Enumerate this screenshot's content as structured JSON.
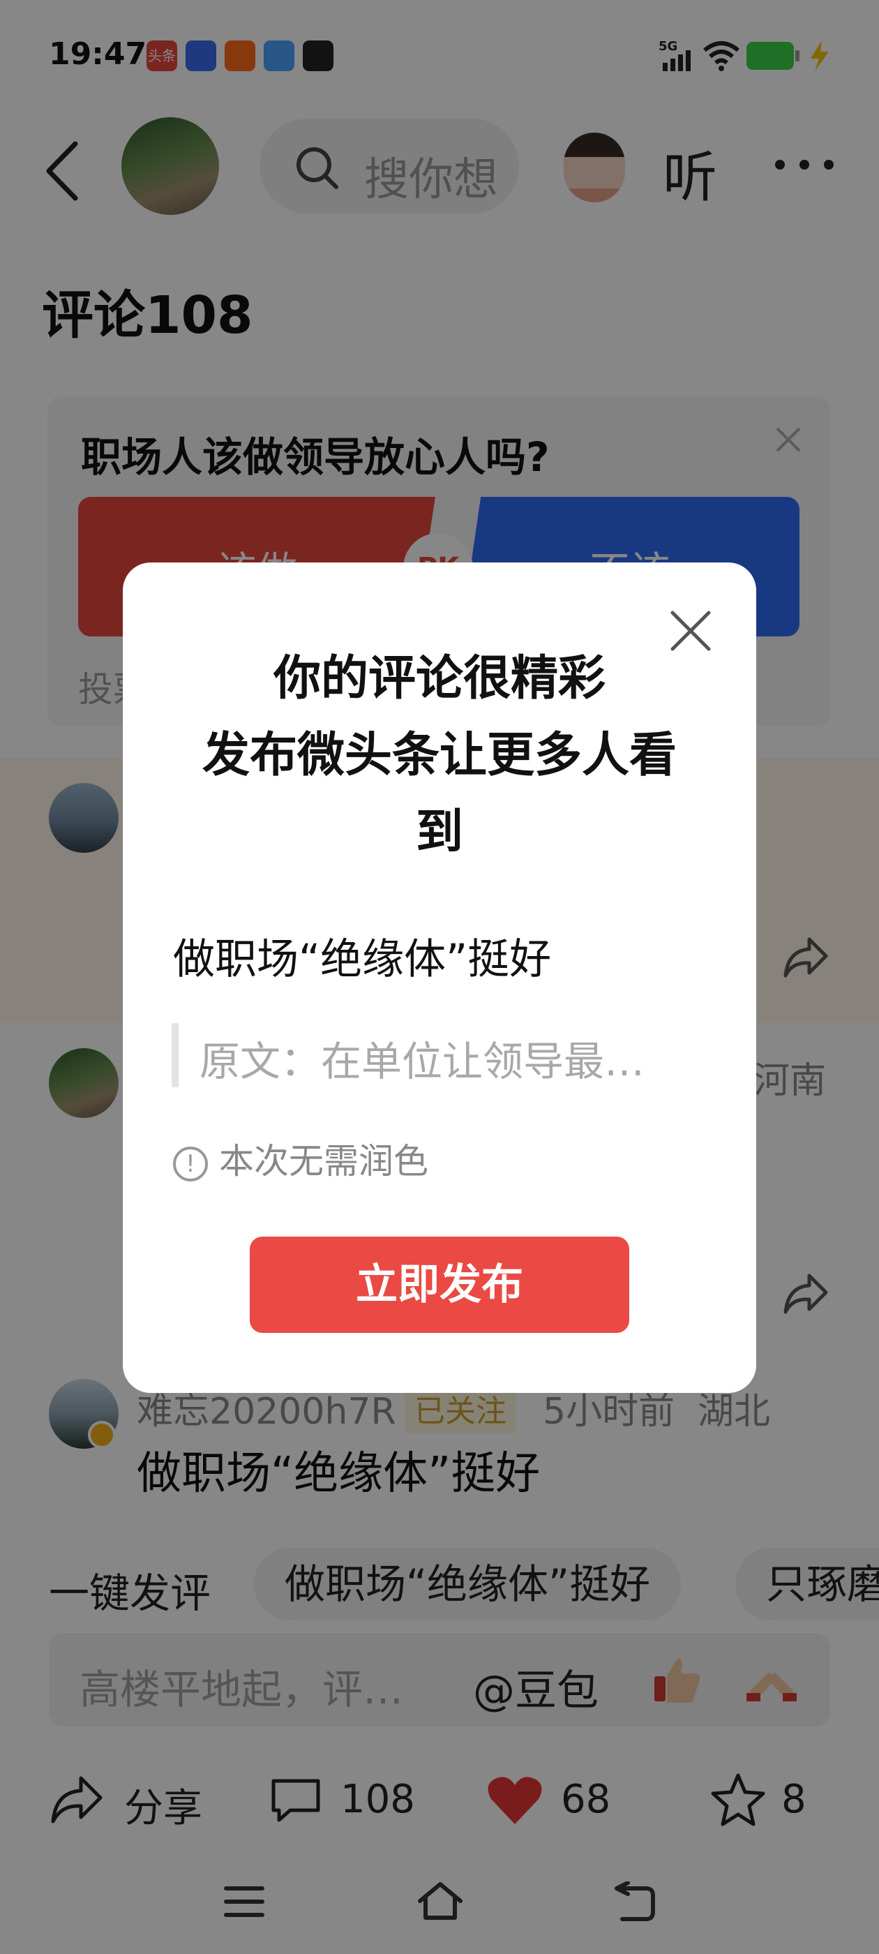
{
  "status_bar": {
    "time": "19:47",
    "network": "5G",
    "app_icons": [
      "头条",
      "百度",
      "快手",
      "文件",
      "游戏"
    ]
  },
  "header": {
    "search_placeholder": "搜你想",
    "listen_label": "听",
    "more_label": "···"
  },
  "comments": {
    "title": "评论108"
  },
  "poll": {
    "question": "职场人该做领导放心人吗?",
    "option_yes": "该做",
    "option_no": "不该",
    "pk_label": "PK",
    "footer": "投票"
  },
  "comment_list": [
    {
      "location": "河南"
    },
    {
      "name": "难忘20200h7R",
      "tag": "已关注",
      "time": "5小时前",
      "location": "湖北",
      "text": "做职场“绝缘体”挺好"
    }
  ],
  "quick_reply": {
    "label": "一键发评",
    "chips": [
      "做职场“绝缘体”挺好",
      "只琢磨"
    ]
  },
  "input_bar": {
    "placeholder": "高楼平地起，评…",
    "mention": "@豆包"
  },
  "actions": {
    "share": "分享",
    "comments_count": "108",
    "likes_count": "68",
    "favorites_count": "8"
  },
  "dialog": {
    "title_line1": "你的评论很精彩",
    "title_line2": "发布微头条让更多人看",
    "title_line3": "到",
    "comment_text": "做职场“绝缘体”挺好",
    "original_text": "原文：在单位让领导最…",
    "hint": "本次无需润色",
    "publish_button": "立即发布"
  },
  "colors": {
    "overlay": "#000000",
    "publish_button": "#ea4a43",
    "poll_red": "#e8473d",
    "poll_blue": "#2f6cf6",
    "heart": "#e83535"
  }
}
